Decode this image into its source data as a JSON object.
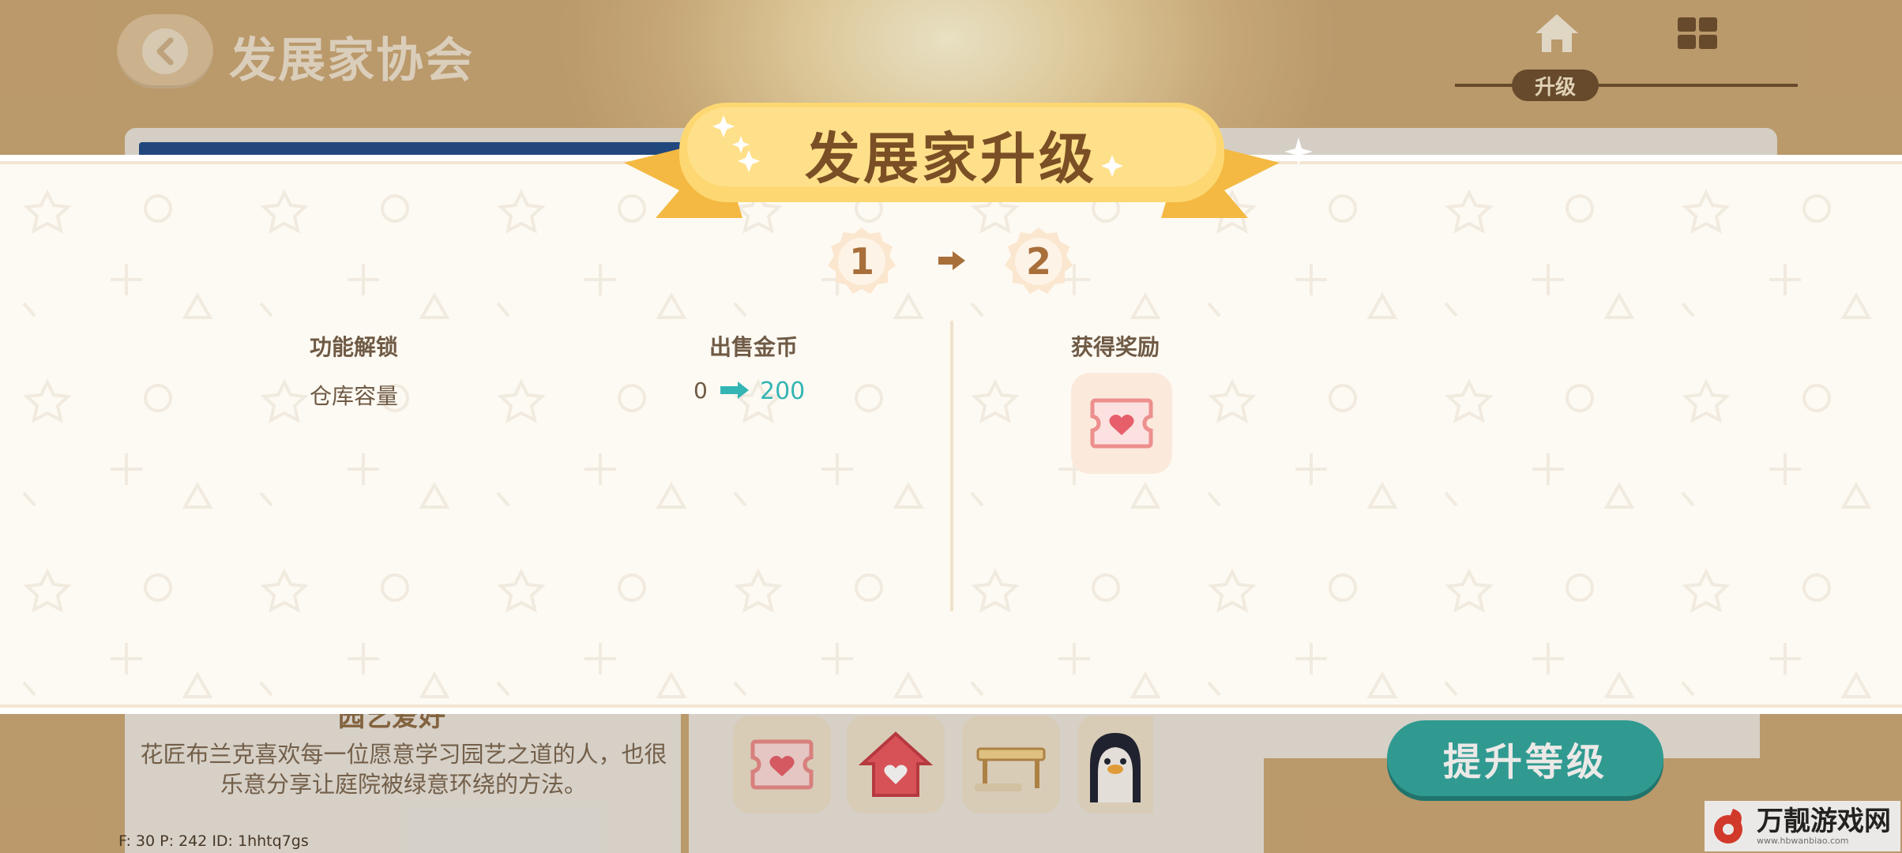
{
  "header": {
    "title": "发展家协会",
    "nav_active_label": "升级"
  },
  "modal": {
    "title": "发展家升级",
    "level_from": "1",
    "level_to": "2",
    "unlock_header": "功能解锁",
    "sell_header": "出售金币",
    "reward_header": "获得奖励",
    "unlock_item": "仓库容量",
    "value_old": "0",
    "value_new": "200"
  },
  "background": {
    "garden_title": "园艺爱好",
    "garden_desc": "花匠布兰克喜欢每一位愿意学习园艺之道的人，也很乐意分享让庭院被绿意环绕的方法。",
    "upgrade_button": "提升等级",
    "debug": "F: 30    P: 242    ID: 1hhtq7gs"
  },
  "watermark": {
    "text": "万靓游戏网",
    "url": "www.hbwanbiao.com"
  },
  "colors": {
    "accent_teal": "#33b5b4",
    "ribbon_yellow": "#fcd46a",
    "brown": "#7a4f25"
  }
}
